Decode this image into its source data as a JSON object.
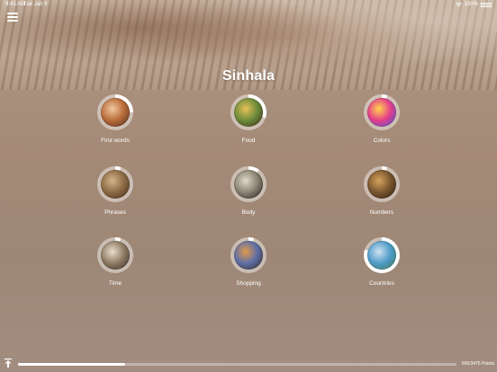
{
  "status_bar": {
    "time": "9:41 AM",
    "date": "Tue Jan 9",
    "battery": "100%"
  },
  "menu": {
    "icon": "hamburger-menu-icon"
  },
  "title": "Sinhala",
  "categories": [
    {
      "label": "First words",
      "progress": 0.25,
      "thumb_colors": [
        "#f2c9a0",
        "#b86b3a",
        "#4a2a1c"
      ]
    },
    {
      "label": "Food",
      "progress": 0.3,
      "thumb_colors": [
        "#e8c25a",
        "#6c8b3a",
        "#3b2a18"
      ]
    },
    {
      "label": "Colors",
      "progress": 0.05,
      "thumb_colors": [
        "#ffd34a",
        "#e43d8a",
        "#3a5bd8"
      ]
    },
    {
      "label": "Phrases",
      "progress": 0.05,
      "thumb_colors": [
        "#d4b48a",
        "#8c6a45",
        "#3f2c1c"
      ]
    },
    {
      "label": "Body",
      "progress": 0.1,
      "thumb_colors": [
        "#e0d9c8",
        "#8a8373",
        "#1d1a16"
      ]
    },
    {
      "label": "Numbers",
      "progress": 0.05,
      "thumb_colors": [
        "#d6a45c",
        "#7a5630",
        "#2a1c10"
      ]
    },
    {
      "label": "Time",
      "progress": 0.05,
      "thumb_colors": [
        "#e7dccb",
        "#8f7b63",
        "#2f2a25"
      ]
    },
    {
      "label": "Shopping",
      "progress": 0.05,
      "thumb_colors": [
        "#e39a4a",
        "#5b6fa8",
        "#3b2416"
      ]
    },
    {
      "label": "Countries",
      "progress": 0.8,
      "thumb_colors": [
        "#cfe2ef",
        "#4f9bc9",
        "#3a7a4b"
      ]
    }
  ],
  "colors": {
    "ring_done": "#ffffff",
    "ring_remaining": "rgba(255,255,255,0.45)"
  },
  "footer": {
    "points_text": "606/3475 Points",
    "progress": 0.245,
    "icon": "upload-icon"
  }
}
